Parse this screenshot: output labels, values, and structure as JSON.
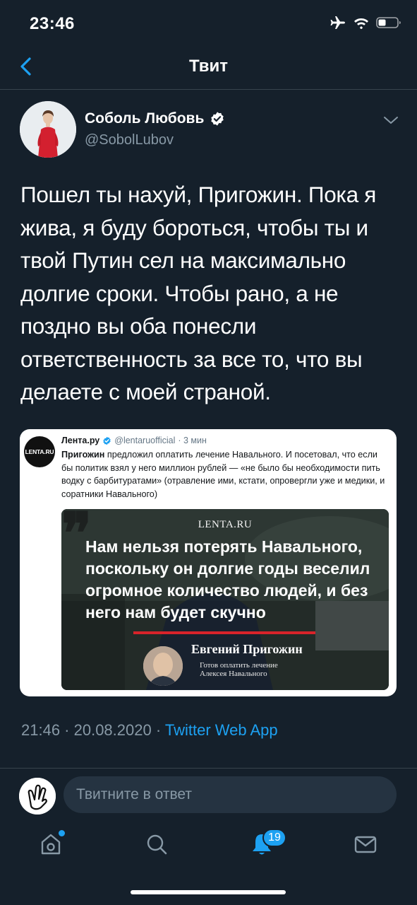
{
  "status_bar": {
    "time": "23:46"
  },
  "nav": {
    "title": "Твит"
  },
  "tweet": {
    "author_name": "Соболь Любовь",
    "author_handle": "@SobolLubov",
    "text": "Пошел ты нахуй, Пригожин. Пока я жива, я буду бороться, чтобы ты и твой Путин сел на максимально долгие сроки. Чтобы рано, а не поздно вы оба понесли ответственность за все то, что вы делаете с моей страной.",
    "timestamp": "21:46 · 20.08.2020 · ",
    "source_app": "Twitter Web App"
  },
  "embedded": {
    "avatar_text": "LENTA.RU",
    "name": "Лента.ру",
    "handle": "@lentaruofficial",
    "time": "· 3 мин",
    "bold_lead": "Пригожин",
    "text": " предложил оплатить лечение Навального. И посетовал, что если бы политик взял у него миллион рублей — «не было бы необходимости пить водку с барбитуратами» (отравление ими, кстати, опровергли уже и медики, и соратники Навального)",
    "image": {
      "brand": "LENTA.RU",
      "quote": "Нам нельзя потерять Навального, поскольку он долгие годы веселил огромное количество людей, и без него нам будет скучно",
      "person": "Евгений Пригожин",
      "caption_line1": "Готов оплатить лечение",
      "caption_line2": "Алексея Навального"
    }
  },
  "reply": {
    "placeholder": "Твитните в ответ"
  },
  "tabbar": {
    "notifications_badge": "19"
  },
  "colors": {
    "background": "#15202b",
    "accent": "#1da1f2",
    "muted": "#8899a6",
    "divider": "#38444d"
  }
}
